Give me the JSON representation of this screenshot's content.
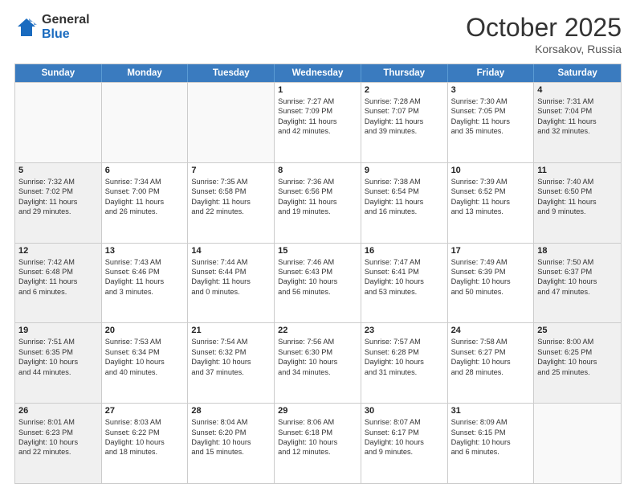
{
  "logo": {
    "general": "General",
    "blue": "Blue"
  },
  "title": "October 2025",
  "location": "Korsakov, Russia",
  "days": [
    "Sunday",
    "Monday",
    "Tuesday",
    "Wednesday",
    "Thursday",
    "Friday",
    "Saturday"
  ],
  "rows": [
    [
      {
        "day": "",
        "lines": []
      },
      {
        "day": "",
        "lines": []
      },
      {
        "day": "",
        "lines": []
      },
      {
        "day": "1",
        "lines": [
          "Sunrise: 7:27 AM",
          "Sunset: 7:09 PM",
          "Daylight: 11 hours",
          "and 42 minutes."
        ]
      },
      {
        "day": "2",
        "lines": [
          "Sunrise: 7:28 AM",
          "Sunset: 7:07 PM",
          "Daylight: 11 hours",
          "and 39 minutes."
        ]
      },
      {
        "day": "3",
        "lines": [
          "Sunrise: 7:30 AM",
          "Sunset: 7:05 PM",
          "Daylight: 11 hours",
          "and 35 minutes."
        ]
      },
      {
        "day": "4",
        "lines": [
          "Sunrise: 7:31 AM",
          "Sunset: 7:04 PM",
          "Daylight: 11 hours",
          "and 32 minutes."
        ]
      }
    ],
    [
      {
        "day": "5",
        "lines": [
          "Sunrise: 7:32 AM",
          "Sunset: 7:02 PM",
          "Daylight: 11 hours",
          "and 29 minutes."
        ]
      },
      {
        "day": "6",
        "lines": [
          "Sunrise: 7:34 AM",
          "Sunset: 7:00 PM",
          "Daylight: 11 hours",
          "and 26 minutes."
        ]
      },
      {
        "day": "7",
        "lines": [
          "Sunrise: 7:35 AM",
          "Sunset: 6:58 PM",
          "Daylight: 11 hours",
          "and 22 minutes."
        ]
      },
      {
        "day": "8",
        "lines": [
          "Sunrise: 7:36 AM",
          "Sunset: 6:56 PM",
          "Daylight: 11 hours",
          "and 19 minutes."
        ]
      },
      {
        "day": "9",
        "lines": [
          "Sunrise: 7:38 AM",
          "Sunset: 6:54 PM",
          "Daylight: 11 hours",
          "and 16 minutes."
        ]
      },
      {
        "day": "10",
        "lines": [
          "Sunrise: 7:39 AM",
          "Sunset: 6:52 PM",
          "Daylight: 11 hours",
          "and 13 minutes."
        ]
      },
      {
        "day": "11",
        "lines": [
          "Sunrise: 7:40 AM",
          "Sunset: 6:50 PM",
          "Daylight: 11 hours",
          "and 9 minutes."
        ]
      }
    ],
    [
      {
        "day": "12",
        "lines": [
          "Sunrise: 7:42 AM",
          "Sunset: 6:48 PM",
          "Daylight: 11 hours",
          "and 6 minutes."
        ]
      },
      {
        "day": "13",
        "lines": [
          "Sunrise: 7:43 AM",
          "Sunset: 6:46 PM",
          "Daylight: 11 hours",
          "and 3 minutes."
        ]
      },
      {
        "day": "14",
        "lines": [
          "Sunrise: 7:44 AM",
          "Sunset: 6:44 PM",
          "Daylight: 11 hours",
          "and 0 minutes."
        ]
      },
      {
        "day": "15",
        "lines": [
          "Sunrise: 7:46 AM",
          "Sunset: 6:43 PM",
          "Daylight: 10 hours",
          "and 56 minutes."
        ]
      },
      {
        "day": "16",
        "lines": [
          "Sunrise: 7:47 AM",
          "Sunset: 6:41 PM",
          "Daylight: 10 hours",
          "and 53 minutes."
        ]
      },
      {
        "day": "17",
        "lines": [
          "Sunrise: 7:49 AM",
          "Sunset: 6:39 PM",
          "Daylight: 10 hours",
          "and 50 minutes."
        ]
      },
      {
        "day": "18",
        "lines": [
          "Sunrise: 7:50 AM",
          "Sunset: 6:37 PM",
          "Daylight: 10 hours",
          "and 47 minutes."
        ]
      }
    ],
    [
      {
        "day": "19",
        "lines": [
          "Sunrise: 7:51 AM",
          "Sunset: 6:35 PM",
          "Daylight: 10 hours",
          "and 44 minutes."
        ]
      },
      {
        "day": "20",
        "lines": [
          "Sunrise: 7:53 AM",
          "Sunset: 6:34 PM",
          "Daylight: 10 hours",
          "and 40 minutes."
        ]
      },
      {
        "day": "21",
        "lines": [
          "Sunrise: 7:54 AM",
          "Sunset: 6:32 PM",
          "Daylight: 10 hours",
          "and 37 minutes."
        ]
      },
      {
        "day": "22",
        "lines": [
          "Sunrise: 7:56 AM",
          "Sunset: 6:30 PM",
          "Daylight: 10 hours",
          "and 34 minutes."
        ]
      },
      {
        "day": "23",
        "lines": [
          "Sunrise: 7:57 AM",
          "Sunset: 6:28 PM",
          "Daylight: 10 hours",
          "and 31 minutes."
        ]
      },
      {
        "day": "24",
        "lines": [
          "Sunrise: 7:58 AM",
          "Sunset: 6:27 PM",
          "Daylight: 10 hours",
          "and 28 minutes."
        ]
      },
      {
        "day": "25",
        "lines": [
          "Sunrise: 8:00 AM",
          "Sunset: 6:25 PM",
          "Daylight: 10 hours",
          "and 25 minutes."
        ]
      }
    ],
    [
      {
        "day": "26",
        "lines": [
          "Sunrise: 8:01 AM",
          "Sunset: 6:23 PM",
          "Daylight: 10 hours",
          "and 22 minutes."
        ]
      },
      {
        "day": "27",
        "lines": [
          "Sunrise: 8:03 AM",
          "Sunset: 6:22 PM",
          "Daylight: 10 hours",
          "and 18 minutes."
        ]
      },
      {
        "day": "28",
        "lines": [
          "Sunrise: 8:04 AM",
          "Sunset: 6:20 PM",
          "Daylight: 10 hours",
          "and 15 minutes."
        ]
      },
      {
        "day": "29",
        "lines": [
          "Sunrise: 8:06 AM",
          "Sunset: 6:18 PM",
          "Daylight: 10 hours",
          "and 12 minutes."
        ]
      },
      {
        "day": "30",
        "lines": [
          "Sunrise: 8:07 AM",
          "Sunset: 6:17 PM",
          "Daylight: 10 hours",
          "and 9 minutes."
        ]
      },
      {
        "day": "31",
        "lines": [
          "Sunrise: 8:09 AM",
          "Sunset: 6:15 PM",
          "Daylight: 10 hours",
          "and 6 minutes."
        ]
      },
      {
        "day": "",
        "lines": []
      }
    ]
  ]
}
